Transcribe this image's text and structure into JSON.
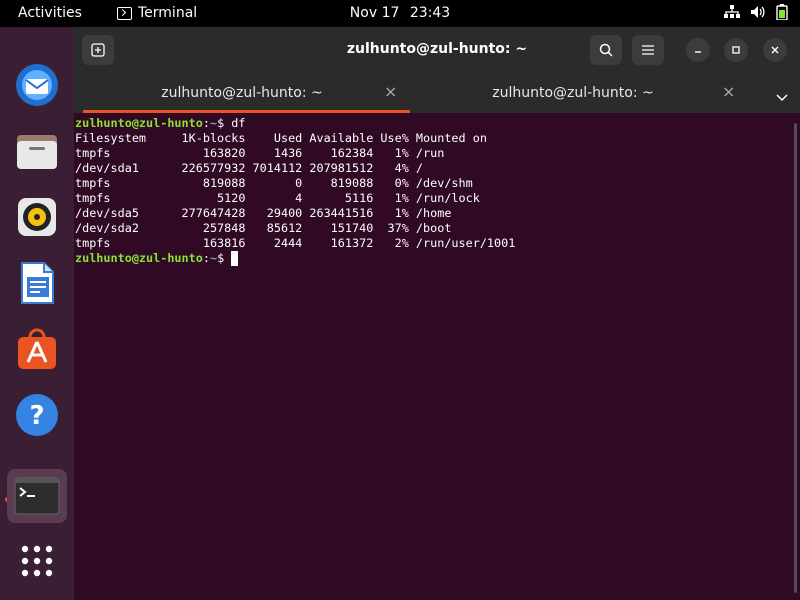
{
  "topbar": {
    "activities": "Activities",
    "app_name": "Terminal",
    "date": "Nov 17",
    "time": "23:43"
  },
  "dock": {
    "apps": [
      "thunderbird-icon",
      "files-icon",
      "rhythmbox-icon",
      "writer-icon",
      "software-icon",
      "help-icon",
      "terminal-icon",
      "app-grid-icon"
    ],
    "accent": "#e95420"
  },
  "window": {
    "title": "zulhunto@zul-hunto: ~",
    "tabs": [
      {
        "label": "zulhunto@zul-hunto: ~",
        "active": true
      },
      {
        "label": "zulhunto@zul-hunto: ~",
        "active": false
      }
    ]
  },
  "terminal": {
    "prompt_user": "zulhunto@zul-hunto",
    "prompt_sep": ":",
    "prompt_path": "~",
    "prompt_sym": "$ ",
    "command": "df",
    "header": "Filesystem     1K-blocks    Used Available Use% Mounted on",
    "rows": [
      "tmpfs             163820    1436    162384   1% /run",
      "/dev/sda1      226577932 7014112 207981512   4% /",
      "tmpfs             819088       0    819088   0% /dev/shm",
      "tmpfs               5120       4      5116   1% /run/lock",
      "/dev/sda5      277647428   29400 263441516   1% /home",
      "/dev/sda2         257848   85612    151740  37% /boot",
      "tmpfs             163816    2444    161372   2% /run/user/1001"
    ],
    "colors": {
      "background": "#300a24",
      "user": "#8ae234",
      "path": "#729fcf"
    }
  }
}
